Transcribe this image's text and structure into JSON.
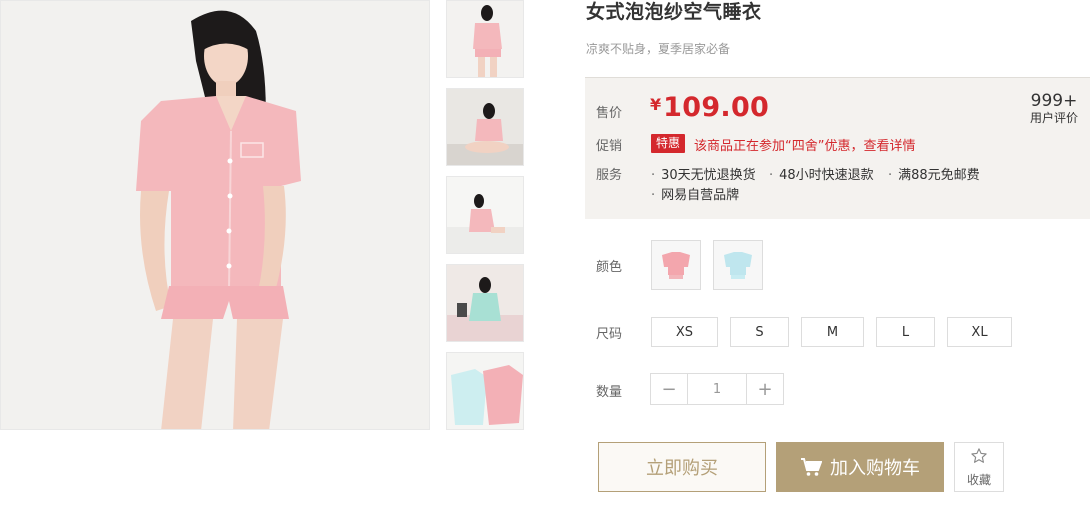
{
  "product": {
    "title": "女式泡泡纱空气睡衣",
    "subtitle": "凉爽不贴身，夏季居家必备"
  },
  "price": {
    "label": "售价",
    "currency": "¥",
    "value": "109.00",
    "color": "#d4282d"
  },
  "reviews": {
    "count": "999+",
    "label": "用户评价"
  },
  "promo": {
    "label": "促销",
    "tag": "特惠",
    "text": "该商品正在参加“四舍”优惠，查看详情"
  },
  "services": {
    "label": "服务",
    "items": [
      "30天无忧退换货",
      "48小时快速退款",
      "满88元免邮费",
      "网易自营品牌"
    ]
  },
  "color_select": {
    "label": "颜色",
    "options": [
      "pink-pajama",
      "blue-pajama"
    ]
  },
  "size_select": {
    "label": "尺码",
    "options": [
      "XS",
      "S",
      "M",
      "L",
      "XL"
    ]
  },
  "quantity": {
    "label": "数量",
    "minus": "−",
    "value": "1",
    "plus": "+"
  },
  "actions": {
    "buy_now": "立即购买",
    "add_to_cart": "加入购物车",
    "favorite": "收藏"
  },
  "theme": {
    "accent": "#b4a078",
    "price_bg": "#f4f2ef"
  },
  "icons": [
    "cart-icon",
    "star-icon"
  ]
}
